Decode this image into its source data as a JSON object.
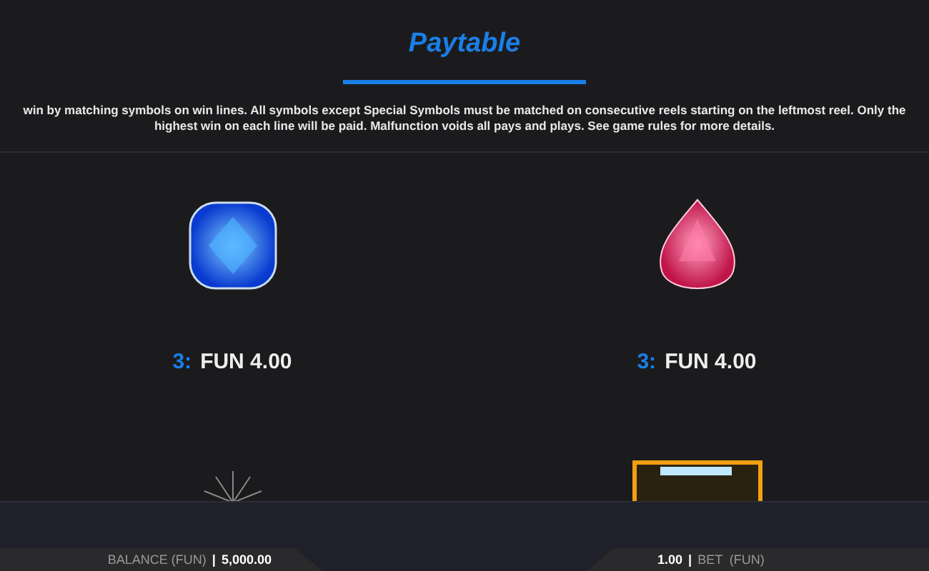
{
  "title": "Paytable",
  "description": "win by matching symbols on win lines. All symbols except Special Symbols must be matched on consecutive reels starting on the leftmost reel. Only the highest win on each line will be paid. Malfunction voids all pays and plays. See game rules for more details.",
  "symbols": [
    {
      "kind": "blue-gem",
      "count": "3:",
      "payout": "FUN 4.00"
    },
    {
      "kind": "red-gem",
      "count": "3:",
      "payout": "FUN 4.00"
    },
    {
      "kind": "sparkle"
    },
    {
      "kind": "gold-frame"
    }
  ],
  "footer": {
    "balance_label": "BALANCE (FUN)",
    "balance_sep": "|",
    "balance": "5,000.00",
    "bet": "1.00",
    "bet_sep": "|",
    "bet_label": "BET  (FUN)"
  }
}
